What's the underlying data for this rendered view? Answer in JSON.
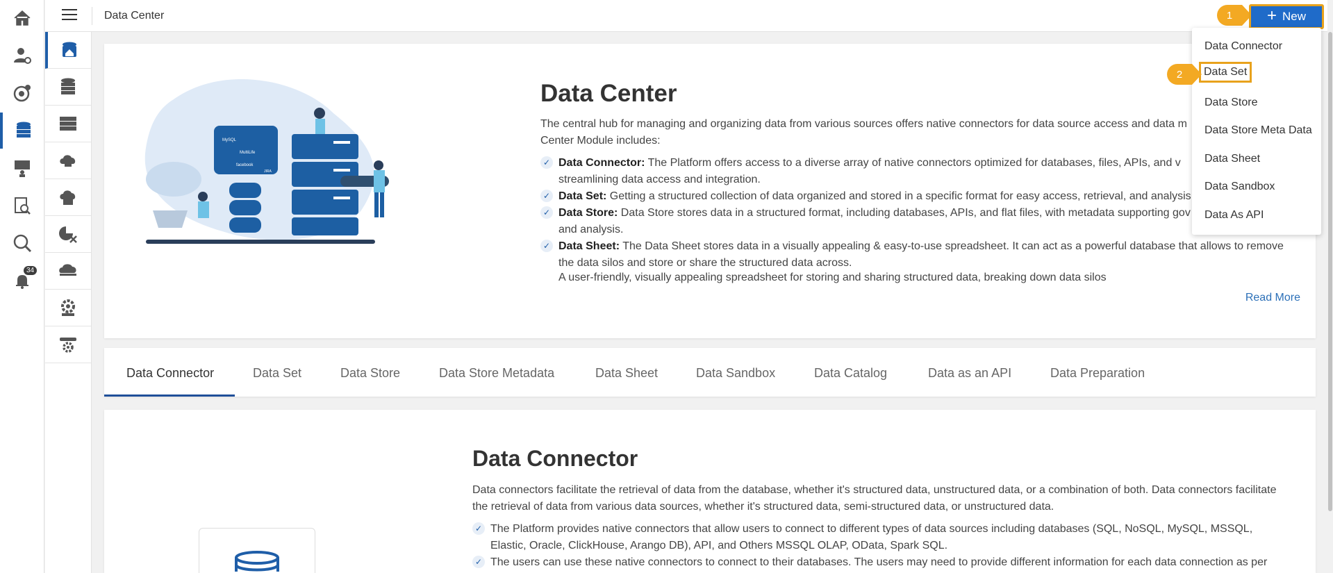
{
  "header": {
    "title": "Data Center",
    "new_label": "New"
  },
  "callouts": {
    "first": "1",
    "second": "2"
  },
  "notifications": {
    "count": "34"
  },
  "dropdown": {
    "items": [
      "Data Connector",
      "Data Set",
      "Data Store",
      "Data Store Meta Data",
      "Data Sheet",
      "Data Sandbox",
      "Data As API"
    ]
  },
  "hero": {
    "title": "Data Center",
    "description": "The central hub for managing and organizing data from various sources offers native connectors for data source access and data m",
    "description_line2": "Center Module includes:",
    "bullets": [
      {
        "term": "Data Connector:",
        "text": " The Platform offers access to a diverse array of native connectors optimized for databases, files, APIs, and v",
        "cont": "streamlining data access and integration."
      },
      {
        "term": "Data Set:",
        "text": " Getting a structured collection of data organized and stored in a specific format for easy access, retrieval, and analysis.",
        "cont": ""
      },
      {
        "term": "Data Store:",
        "text": " Data Store stores data in a structured format, including databases, APIs, and flat files, with metadata supporting gov",
        "cont": "and analysis."
      },
      {
        "term": "Data Sheet:",
        "text": " The Data Sheet stores data in a visually appealing & easy-to-use spreadsheet. It can act as a powerful database that allows to remove",
        "cont": "the data silos and store or share the structured data across."
      }
    ],
    "extra_line": "A user-friendly, visually appealing spreadsheet for storing and sharing structured data, breaking down data silos",
    "read_more": "Read More",
    "illustration_labels": [
      "MySQL",
      "MultiLife",
      "facebook",
      "JIRA"
    ]
  },
  "tabs": [
    "Data Connector",
    "Data Set",
    "Data Store",
    "Data Store Metadata",
    "Data Sheet",
    "Data Sandbox",
    "Data Catalog",
    "Data as an API",
    "Data Preparation"
  ],
  "section": {
    "title": "Data Connector",
    "description": "Data connectors facilitate the retrieval of data from the database, whether it's structured data, unstructured data, or a combination of both. Data connectors facilitate the retrieval of data from various data sources, whether it's structured data, semi-structured data, or unstructured data.",
    "bullets": [
      "The Platform provides native connectors that allow users to connect to different types of data sources including databases (SQL, NoSQL, MySQL, MSSQL, Elastic, Oracle, ClickHouse, Arango DB), API, and Others MSSQL OLAP, OData, Spark SQL.",
      "The users can use these native connectors to connect to their databases. The users may need to provide different information for each data connection as per"
    ]
  },
  "colors": {
    "accent": "#1f6bc9",
    "highlight": "#e8a21c",
    "callout": "#f3a923"
  },
  "icons": {
    "rail": [
      "home-icon",
      "user-settings-icon",
      "target-icon",
      "data-center-icon",
      "presentation-icon",
      "report-search-icon",
      "search-icon",
      "bell-icon"
    ],
    "subrail": [
      "data-home-icon",
      "database-icon",
      "server-icon",
      "cloud-database-icon",
      "cloud-code-icon",
      "chart-tools-icon",
      "cloud-stack-icon",
      "api-gear-icon",
      "pipeline-gear-icon"
    ]
  }
}
